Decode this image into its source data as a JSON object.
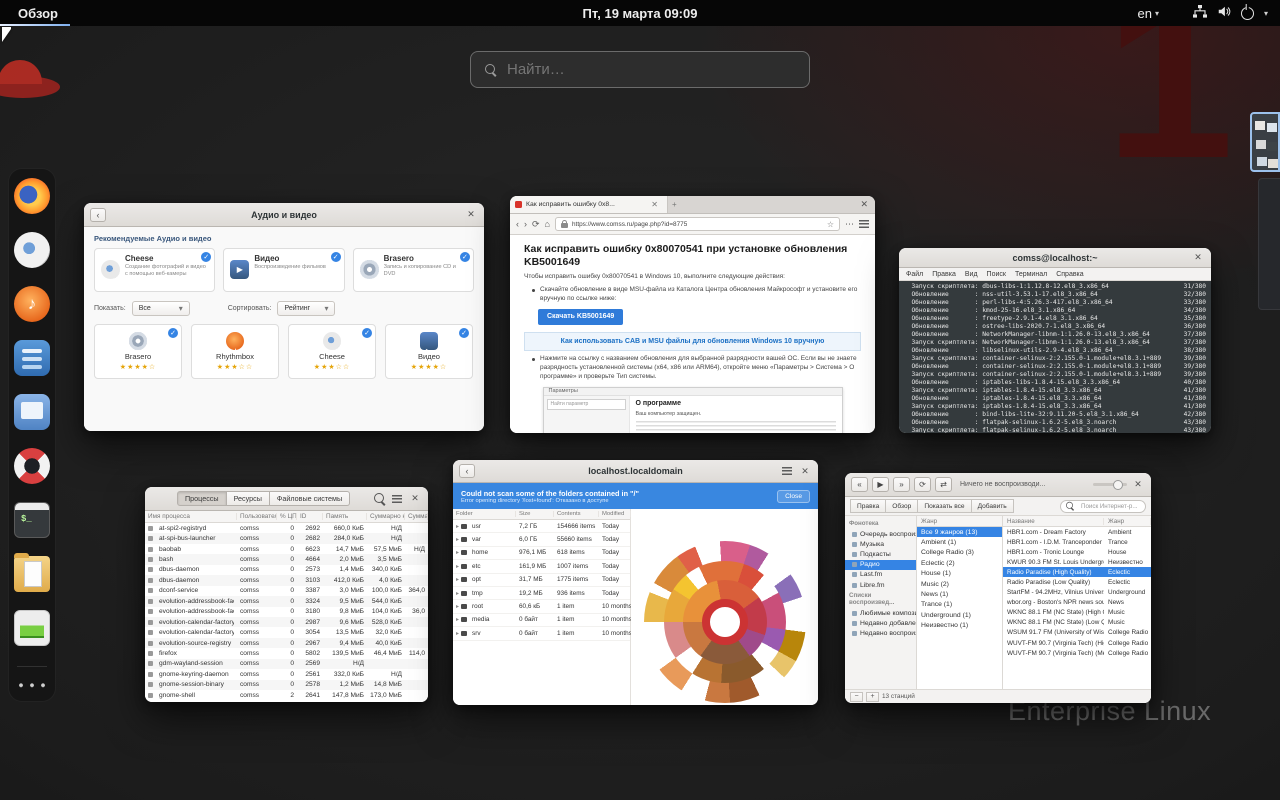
{
  "icons": {
    "close": "✕",
    "back": "‹",
    "forward": "›",
    "reload": "⟳",
    "home": "⌂",
    "star": "☆",
    "caret_down": "▾",
    "prev": "«",
    "play": "▶",
    "next": "»",
    "repeat": "⟳",
    "shuffle": "⇄",
    "plus": "+",
    "minus": "−",
    "dots": "⋯"
  },
  "wallpaper": {
    "watermark_number": "1",
    "watermark_brand": "Enterprise Linux"
  },
  "top_bar": {
    "activities_label": "Обзор",
    "clock": "Пт, 19 марта  09:09",
    "keyboard_layout": "en"
  },
  "search": {
    "placeholder": "Найти…"
  },
  "dash": {
    "items": [
      "firefox",
      "cheese",
      "rhythmbox",
      "software",
      "boxes",
      "help",
      "terminal",
      "files",
      "system-monitor"
    ],
    "show_apps": "show-applications"
  },
  "windows": {
    "software": {
      "title": "Аудио и видео",
      "section_label": "Рекомендуемые Аудио и видео",
      "featured": [
        {
          "name": "Cheese",
          "desc": "Создание фотографий и видео с помощью веб-камеры",
          "icon": "camera",
          "installed": true
        },
        {
          "name": "Видео",
          "desc": "Воспроизведение фильмов",
          "icon": "video",
          "installed": true
        },
        {
          "name": "Brasero",
          "desc": "Запись и копирование CD и DVD",
          "icon": "disc",
          "installed": true
        }
      ],
      "show_label": "Показать:",
      "show_value": "Все",
      "sort_label": "Сортировать:",
      "sort_value": "Рейтинг",
      "apps": [
        {
          "name": "Brasero",
          "stars": "★★★★☆",
          "icon": "disc",
          "installed": true
        },
        {
          "name": "Rhythmbox",
          "stars": "★★★☆☆",
          "icon": "note",
          "installed": false
        },
        {
          "name": "Cheese",
          "stars": "★★★☆☆",
          "icon": "camera",
          "installed": true
        },
        {
          "name": "Видео",
          "stars": "★★★★☆",
          "icon": "video",
          "installed": true
        }
      ]
    },
    "firefox": {
      "tab_title": "Как исправить ошибку 0x8...",
      "url": "https://www.comss.ru/page.php?id=8775",
      "heading": "Как исправить ошибку 0x80070541 при установке обновления KB5001649",
      "intro": "Чтобы исправить ошибку 0x80070541 в Windows 10, выполните следующие действия:",
      "bullet1": "Скачайте обновление в виде MSU-файла из Каталога Центра обновления Майкрософт и установите его вручную по ссылке ниже:",
      "download_button": "Скачать KB5001649",
      "info_link": "Как использовать CAB и MSU файлы для обновления Windows 10 вручную",
      "bullet2": "Нажмите на ссылку с названием обновления для выбранной разрядности вашей ОС. Если вы не знаете разрядность установленной системы (x64, x86 или ARM64), откройте меню «Параметры > Система > О программе» и проверьте Тип системы.",
      "embed": {
        "title": "Параметры",
        "search_placeholder": "Найти параметр",
        "page_title": "О программе",
        "line1": "Ваш компьютер защищен."
      }
    },
    "terminal": {
      "title": "comss@localhost:~",
      "menu": [
        "Файл",
        "Правка",
        "Вид",
        "Поиск",
        "Терминал",
        "Справка"
      ],
      "lines": [
        {
          "t": "  Запуск скриптлета: dbus-libs-1:1.12.8-12.el8_3.x86_64",
          "n": "31/380"
        },
        {
          "t": "  Обновление       : nss-util-3.53.1-17.el8_3.x86_64",
          "n": "32/380"
        },
        {
          "t": "  Обновление       : perl-libs-4:5.26.3-417.el8_3.x86_64",
          "n": "33/380"
        },
        {
          "t": "  Обновление       : kmod-25-16.el8_3.1.x86_64",
          "n": "34/380"
        },
        {
          "t": "  Обновление       : freetype-2.9.1-4.el8_3.1.x86_64",
          "n": "35/380"
        },
        {
          "t": "  Обновление       : ostree-libs-2020.7-1.el8_3.x86_64",
          "n": "36/380"
        },
        {
          "t": "  Обновление       : NetworkManager-libnm-1:1.26.0-13.el8_3.x86_64",
          "n": "37/380"
        },
        {
          "t": "  Запуск скриптлета: NetworkManager-libnm-1:1.26.0-13.el8_3.x86_64",
          "n": "37/380"
        },
        {
          "t": "  Обновление       : libselinux-utils-2.9-4.el8_3.x86_64",
          "n": "38/380"
        },
        {
          "t": "  Запуск скриптлета: container-selinux-2:2.155.0-1.module+el8.3.1+889",
          "n": "39/380"
        },
        {
          "t": "  Обновление       : container-selinux-2:2.155.0-1.module+el8.3.1+889",
          "n": "39/380"
        },
        {
          "t": "  Запуск скриптлета: container-selinux-2:2.155.0-1.module+el8.3.1+889",
          "n": "39/380"
        },
        {
          "t": "  Обновление       : iptables-libs-1.8.4-15.el8_3.3.x86_64",
          "n": "40/380"
        },
        {
          "t": "  Запуск скриптлета: iptables-1.8.4-15.el8_3.3.x86_64",
          "n": "41/380"
        },
        {
          "t": "  Обновление       : iptables-1.8.4-15.el8_3.3.x86_64",
          "n": "41/380"
        },
        {
          "t": "  Запуск скриптлета: iptables-1.8.4-15.el8_3.3.x86_64",
          "n": "41/380"
        },
        {
          "t": "  Обновление       : bind-libs-lite-32:9.11.20-5.el8_3.1.x86_64",
          "n": "42/380"
        },
        {
          "t": "  Обновление       : flatpak-selinux-1.6.2-5.el8_3.noarch",
          "n": "43/380"
        },
        {
          "t": "  Запуск скриптлета: flatpak-selinux-1.6.2-5.el8_3.noarch",
          "n": "43/380"
        }
      ]
    },
    "system_monitor": {
      "tabs": [
        "Процессы",
        "Ресурсы",
        "Файловые системы"
      ],
      "columns": [
        "Имя процесса",
        "Пользователь",
        "% ЦП",
        "ID",
        "Память",
        "Суммарно к...",
        "Суммар..."
      ],
      "processes": [
        [
          "at-spi2-registryd",
          "comss",
          "0",
          "2692",
          "660,0 КиБ",
          "Н/Д",
          ""
        ],
        [
          "at-spi-bus-launcher",
          "comss",
          "0",
          "2682",
          "284,0 КиБ",
          "Н/Д",
          ""
        ],
        [
          "baobab",
          "comss",
          "0",
          "6623",
          "14,7 МиБ",
          "57,5 МиБ",
          "Н/Д"
        ],
        [
          "bash",
          "comss",
          "0",
          "4664",
          "2,0 МиБ",
          "3,5 МиБ",
          ""
        ],
        [
          "dbus-daemon",
          "comss",
          "0",
          "2573",
          "1,4 МиБ",
          "340,0 КиБ",
          ""
        ],
        [
          "dbus-daemon",
          "comss",
          "0",
          "3103",
          "412,0 КиБ",
          "4,0 КиБ",
          ""
        ],
        [
          "dconf-service",
          "comss",
          "0",
          "3387",
          "3,0 МиБ",
          "100,0 КиБ",
          "364,0"
        ],
        [
          "evolution-addressbook-factory",
          "comss",
          "0",
          "3324",
          "9,5 МиБ",
          "544,0 КиБ",
          ""
        ],
        [
          "evolution-addressbook-factory-...",
          "comss",
          "0",
          "3180",
          "9,8 МиБ",
          "104,0 КиБ",
          "36,0"
        ],
        [
          "evolution-calendar-factory",
          "comss",
          "0",
          "2987",
          "9,6 МиБ",
          "528,0 КиБ",
          ""
        ],
        [
          "evolution-calendar-factory-subp...",
          "comss",
          "0",
          "3054",
          "13,5 МиБ",
          "32,0 КиБ",
          ""
        ],
        [
          "evolution-source-registry",
          "comss",
          "0",
          "2967",
          "9,4 МиБ",
          "40,0 КиБ",
          ""
        ],
        [
          "firefox",
          "comss",
          "0",
          "5802",
          "139,5 МиБ",
          "46,4 МиБ",
          "114,0"
        ],
        [
          "gdm-wayland-session",
          "comss",
          "0",
          "2569",
          "Н/Д",
          "",
          ""
        ],
        [
          "gnome-keyring-daemon",
          "comss",
          "0",
          "2561",
          "332,0 КиБ",
          "Н/Д",
          ""
        ],
        [
          "gnome-session-binary",
          "comss",
          "0",
          "2578",
          "1,2 МиБ",
          "14,8 МиБ",
          ""
        ],
        [
          "gnome-shell",
          "comss",
          "2",
          "2641",
          "147,8 МиБ",
          "173,0 МиБ",
          ""
        ]
      ]
    },
    "baobab": {
      "title": "localhost.localdomain",
      "infobar": {
        "title": "Could not scan some of the folders contained in \"/\"",
        "subtitle": "Error opening directory '/lost+found': Отказано в доступе",
        "close_button": "Close"
      },
      "columns": [
        "Folder",
        "Size",
        "Contents",
        "Modified"
      ],
      "folders": [
        {
          "name": "usr",
          "size": "7,2 ГБ",
          "contents": "154666 items",
          "modified": "Today"
        },
        {
          "name": "var",
          "size": "6,0 ГБ",
          "contents": "55660 items",
          "modified": "Today"
        },
        {
          "name": "home",
          "size": "976,1 МБ",
          "contents": "618 items",
          "modified": "Today"
        },
        {
          "name": "etc",
          "size": "161,9 МБ",
          "contents": "1007 items",
          "modified": "Today"
        },
        {
          "name": "opt",
          "size": "31,7 МБ",
          "contents": "1775 items",
          "modified": "Today"
        },
        {
          "name": "tmp",
          "size": "19,2 МБ",
          "contents": "936 items",
          "modified": "Today"
        },
        {
          "name": "root",
          "size": "60,6 кБ",
          "contents": "1 item",
          "modified": "10 months"
        },
        {
          "name": "media",
          "size": "0 байт",
          "contents": "1 item",
          "modified": "10 months"
        },
        {
          "name": "srv",
          "size": "0 байт",
          "contents": "1 item",
          "modified": "10 months"
        }
      ]
    },
    "rhythmbox": {
      "now_playing": "Ничего не воспроизводи...",
      "toolbar": [
        "Правка",
        "Обзор",
        "Показать все",
        "Добавить"
      ],
      "search_placeholder": "Поиск Интернет-р...",
      "sidebar": {
        "library_header": "Фонотека",
        "library_items": [
          {
            "label": "Очередь воспроизв..."
          },
          {
            "label": "Музыка"
          },
          {
            "label": "Подкасты"
          },
          {
            "label": "Радио",
            "selected": true
          },
          {
            "label": "Last.fm"
          },
          {
            "label": "Libre.fm"
          }
        ],
        "playlists_header": "Списки воспроизвед...",
        "playlist_items": [
          {
            "label": "Любимые композиции"
          },
          {
            "label": "Недавно добавленные"
          },
          {
            "label": "Недавно воспроизвед..."
          }
        ]
      },
      "genre_header": "Жанр",
      "genres": [
        {
          "label": "Все 9 жанров (13)",
          "selected": true
        },
        {
          "label": "Ambient (1)"
        },
        {
          "label": "College Radio (3)"
        },
        {
          "label": "Eclectic (2)"
        },
        {
          "label": "House (1)"
        },
        {
          "label": "Music (2)"
        },
        {
          "label": "News (1)"
        },
        {
          "label": "Trance (1)"
        },
        {
          "label": "Underground (1)"
        },
        {
          "label": "Неизвестно (1)"
        }
      ],
      "station_columns": [
        "Название",
        "Жанр"
      ],
      "stations": [
        {
          "name": "HBR1.com - Dream Factory",
          "genre": "Ambient"
        },
        {
          "name": "HBR1.com - I.D.M. Tranceponder",
          "genre": "Trance"
        },
        {
          "name": "HBR1.com - Tronic Lounge",
          "genre": "House"
        },
        {
          "name": "KWUR 90.3 FM St. Louis Undergroun...",
          "genre": "Неизвестно"
        },
        {
          "name": "Radio Paradise (High Quality)",
          "genre": "Eclectic",
          "selected": true
        },
        {
          "name": "Radio Paradise (Low Quality)",
          "genre": "Eclectic"
        },
        {
          "name": "StartFM - 94.2MHz, Vilnius Universit...",
          "genre": "Underground"
        },
        {
          "name": "wbor.org - Boston's NPR news source",
          "genre": "News"
        },
        {
          "name": "WKNC 88.1 FM (NC State) (High Qual...",
          "genre": "Music"
        },
        {
          "name": "WKNC 88.1 FM (NC State) (Low Qual...",
          "genre": "Music"
        },
        {
          "name": "WSUM 91.7 FM (University of Wiscon...",
          "genre": "College Radio"
        },
        {
          "name": "WUVT-FM 90.7 (Virginia Tech) (High ...",
          "genre": "College Radio"
        },
        {
          "name": "WUVT-FM 90.7 (Virginia Tech) (Med...",
          "genre": "College Radio"
        }
      ],
      "status": "13 станций"
    }
  }
}
